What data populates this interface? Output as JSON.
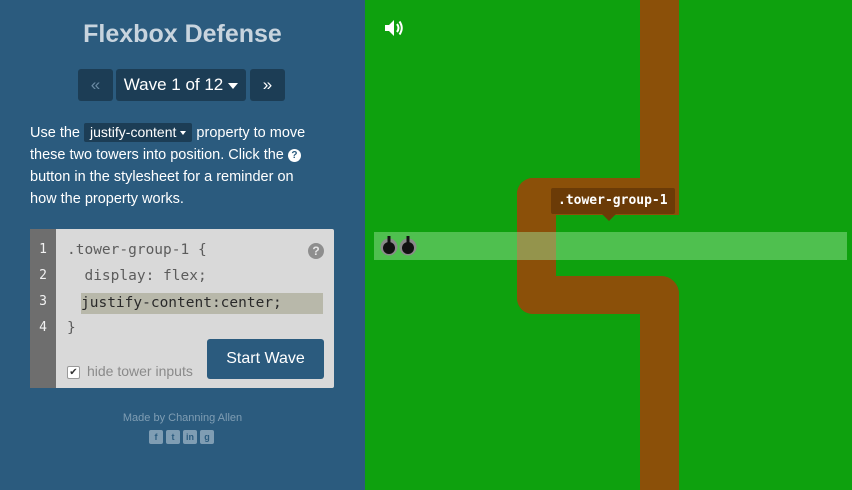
{
  "app": {
    "title": "Flexbox Defense"
  },
  "wave_nav": {
    "prev_label": "«",
    "selector_label": "Wave 1 of 12",
    "next_label": "»"
  },
  "instructions": {
    "line1_before": "Use the",
    "property": "justify-content",
    "line1_after": "property to move",
    "line2_before": "these two towers into position. Click the",
    "line3": "button in the stylesheet for a reminder on",
    "line4": "how the property works."
  },
  "editor": {
    "line_numbers": [
      "1",
      "2",
      "3",
      "4"
    ],
    "line1": ".tower-group-1 {",
    "line2": "  display: flex;",
    "input_value": "justify-content:center;",
    "line4": "}",
    "help_icon": "?",
    "hide_inputs_label": "hide tower inputs",
    "hide_inputs_checked": true,
    "start_button": "Start Wave"
  },
  "footer": {
    "credit": "Made by Channing Allen",
    "social_icons": [
      "facebook-icon",
      "twitter-icon",
      "linkedin-icon",
      "github-icon"
    ]
  },
  "game": {
    "tooltip": ".tower-group-1",
    "tower_count": 2,
    "sound_icon": "speaker-icon"
  },
  "colors": {
    "panel": "#2b5b7e",
    "grass": "#0ea10e",
    "road": "#8b5009",
    "button_dark": "#1c3d55"
  }
}
